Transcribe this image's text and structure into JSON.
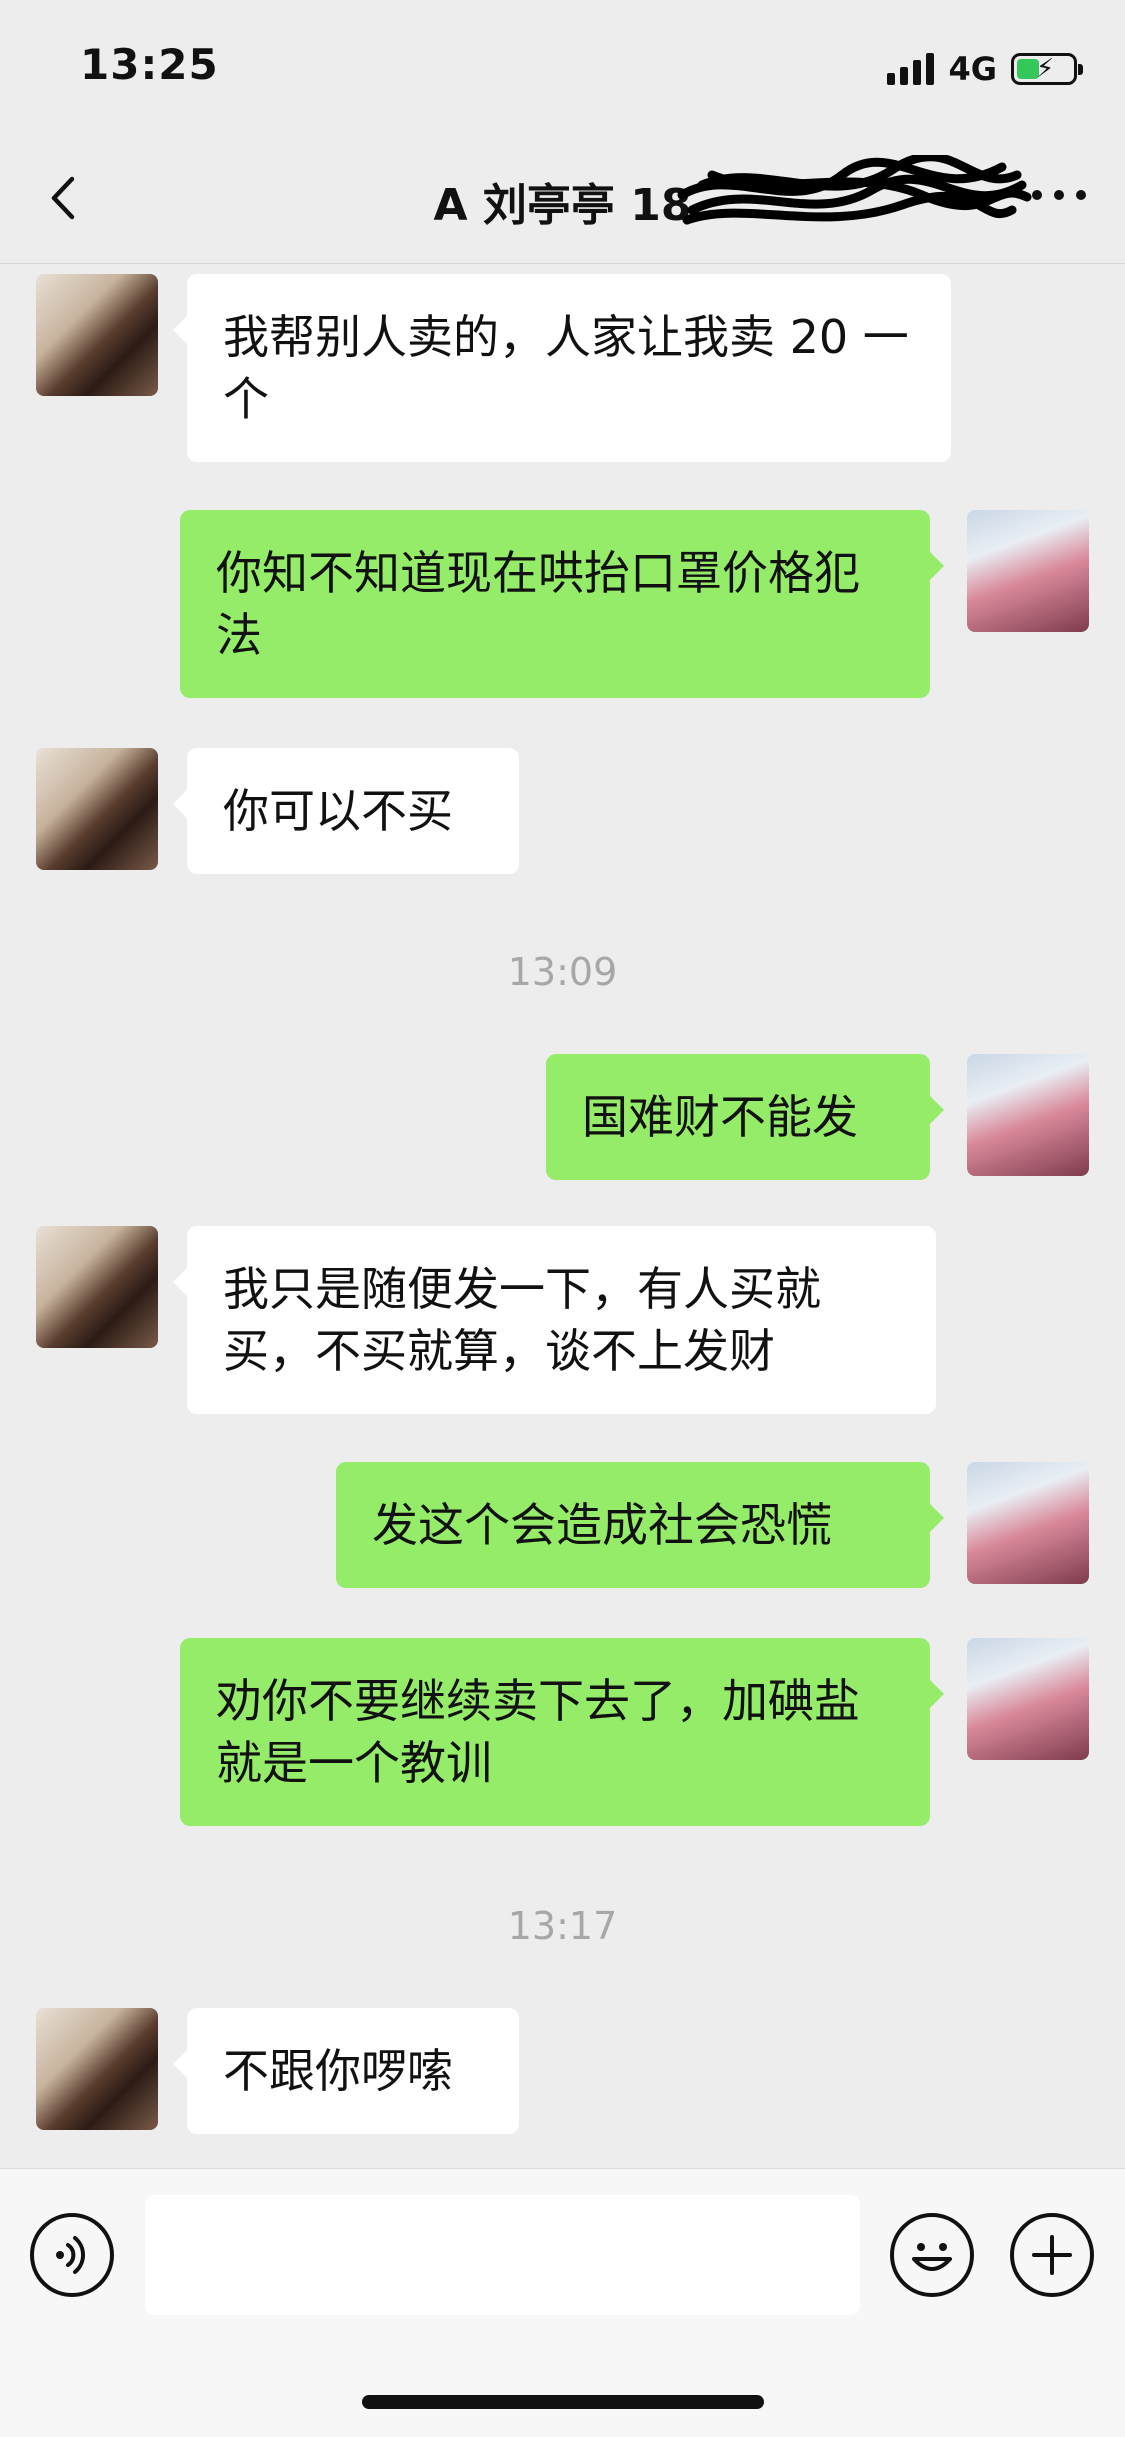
{
  "status_bar": {
    "time": "13:25",
    "network": "4G"
  },
  "nav": {
    "title": "A 刘亭亭 18"
  },
  "messages": [
    {
      "side": "in",
      "text": "我帮别人卖的，人家让我卖 20 一个"
    },
    {
      "side": "out",
      "text": "你知不知道现在哄抬口罩价格犯法"
    },
    {
      "side": "in",
      "text": "你可以不买"
    },
    {
      "type": "time",
      "text": "13:09"
    },
    {
      "side": "out",
      "text": "国难财不能发"
    },
    {
      "side": "in",
      "text": "我只是随便发一下，有人买就买，不买就算，谈不上发财"
    },
    {
      "side": "out",
      "text": "发这个会造成社会恐慌"
    },
    {
      "side": "out",
      "text": "劝你不要继续卖下去了，加碘盐就是一个教训"
    },
    {
      "type": "time",
      "text": "13:17"
    },
    {
      "side": "in",
      "text": "不跟你啰嗦"
    }
  ],
  "input": {
    "value": ""
  },
  "colors": {
    "outgoing_bubble": "#95ec69",
    "incoming_bubble": "#ffffff",
    "background": "#ededed"
  },
  "icons": [
    "back-chevron-icon",
    "more-options-icon",
    "voice-icon",
    "emoji-icon",
    "plus-icon"
  ]
}
